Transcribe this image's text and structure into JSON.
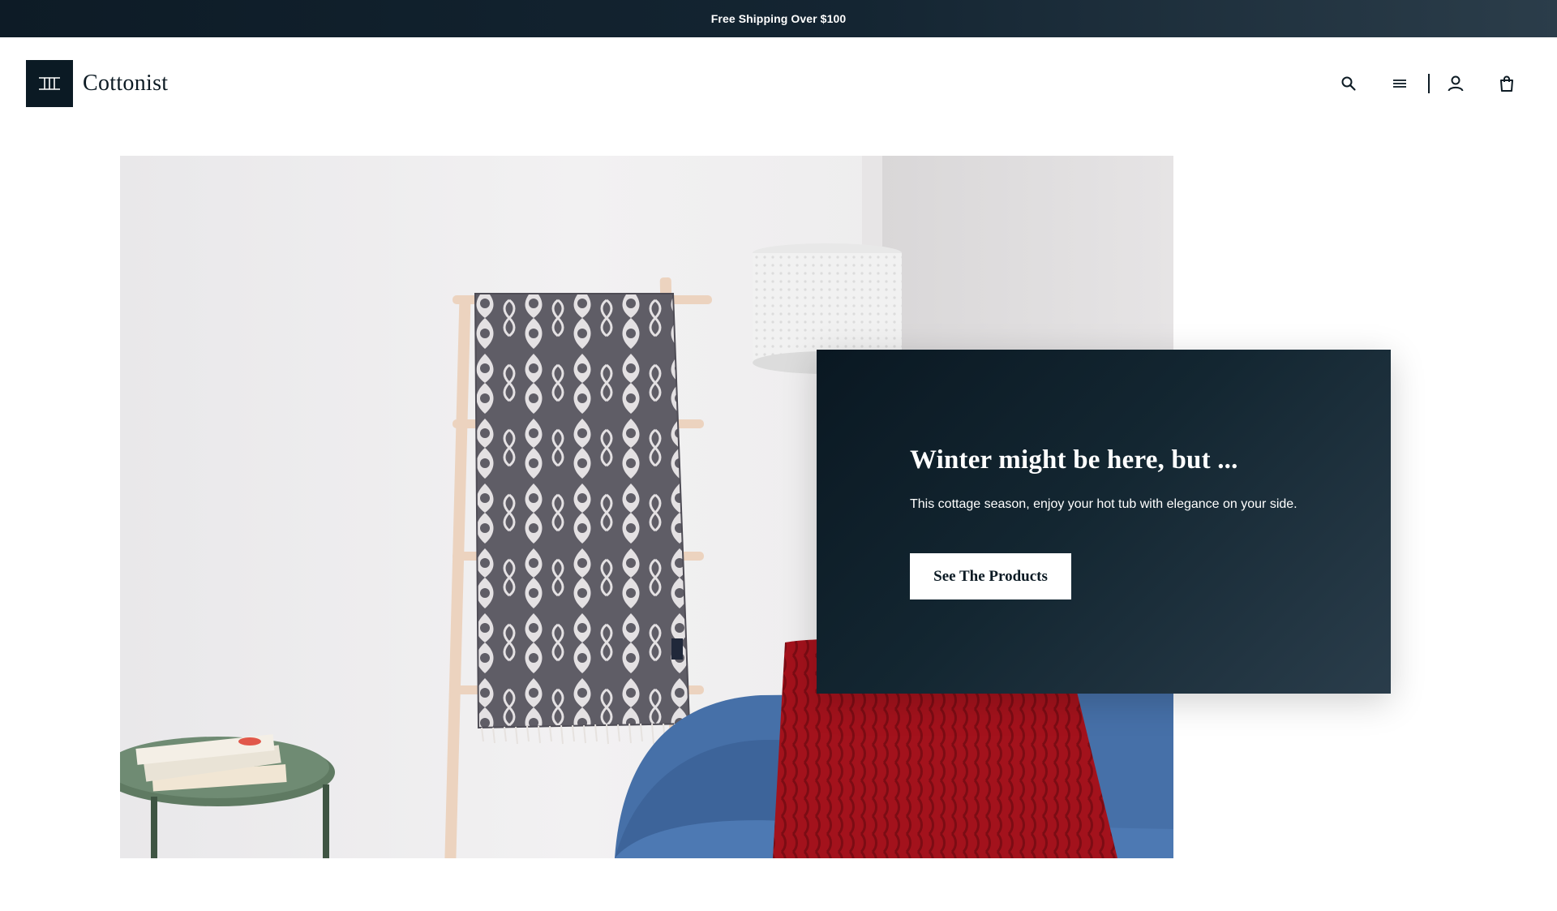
{
  "announcement": {
    "text": "Free Shipping Over $100"
  },
  "brand": {
    "name": "Cottonist",
    "logo_mark_icon": "cottonist-monogram-icon"
  },
  "nav": {
    "icons": [
      "search-icon",
      "menu-icon",
      "account-icon",
      "cart-bag-icon"
    ]
  },
  "hero": {
    "image_icon": "living-room-towel-ladder-image"
  },
  "promo": {
    "title": "Winter might be here, but ...",
    "text": "This cottage season, enjoy your hot tub with elegance on your side.",
    "button_label": "See The Products"
  },
  "colors": {
    "navy": "#0b1a24",
    "white": "#ffffff",
    "accent_red": "#a3121c"
  }
}
